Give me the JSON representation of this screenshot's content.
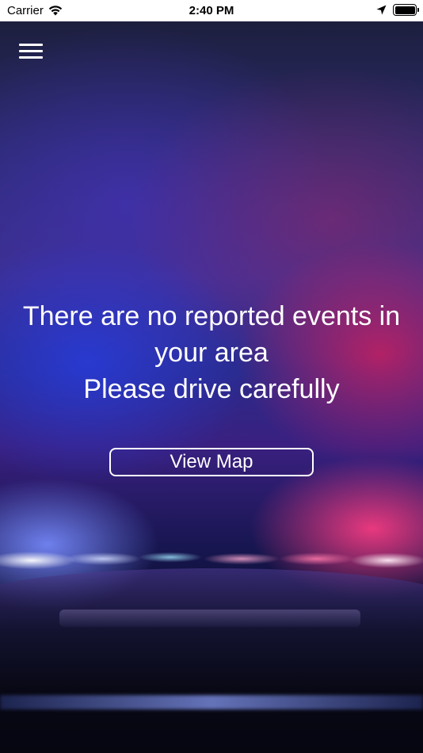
{
  "status_bar": {
    "carrier": "Carrier",
    "time": "2:40 PM",
    "icons": [
      "wifi-icon",
      "location-arrow-icon",
      "battery-icon"
    ]
  },
  "header": {
    "menu_icon": "hamburger-menu-icon"
  },
  "main": {
    "message_line1": "There are no reported events in your area",
    "message_line2": "Please drive carefully",
    "view_map_label": "View Map"
  },
  "colors": {
    "text": "#ffffff",
    "status_bar_bg": "#ffffff",
    "police_blue": "#2a3cdc",
    "police_red": "#dc1e5a"
  }
}
